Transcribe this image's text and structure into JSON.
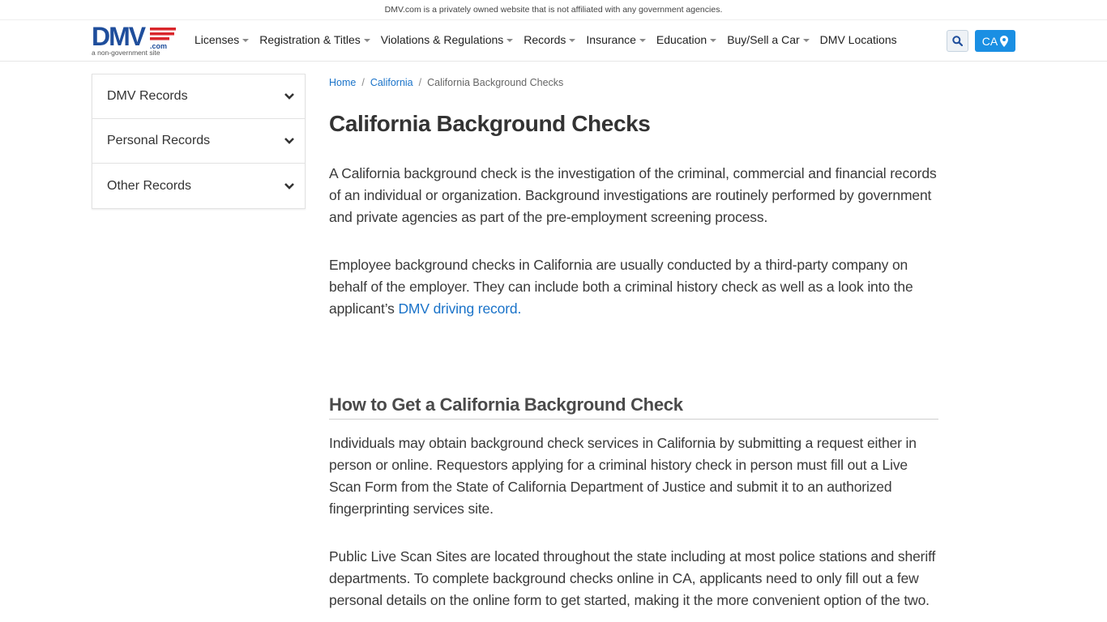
{
  "disclaimer": "DMV.com is a privately owned website that is not affiliated with any government agencies.",
  "logo": {
    "wordmark": "DMV",
    "suffix": ".com",
    "tagline": "a non-government site",
    "brand_color": "#1f4e9c",
    "accent_color": "#d9262b"
  },
  "nav": [
    {
      "label": "Licenses",
      "has_dropdown": true
    },
    {
      "label": "Registration & Titles",
      "has_dropdown": true
    },
    {
      "label": "Violations & Regulations",
      "has_dropdown": true
    },
    {
      "label": "Records",
      "has_dropdown": true
    },
    {
      "label": "Insurance",
      "has_dropdown": true
    },
    {
      "label": "Education",
      "has_dropdown": true
    },
    {
      "label": "Buy/Sell a Car",
      "has_dropdown": true
    },
    {
      "label": "DMV Locations",
      "has_dropdown": false
    }
  ],
  "search": {
    "icon": "search-icon"
  },
  "state_selector": {
    "label": "CA",
    "icon": "map-pin-icon",
    "color": "#1a8fe3"
  },
  "sidebar": {
    "items": [
      {
        "label": "DMV Records",
        "icon": "chevron-down-icon"
      },
      {
        "label": "Personal Records",
        "icon": "chevron-down-icon"
      },
      {
        "label": "Other Records",
        "icon": "chevron-down-icon"
      }
    ]
  },
  "breadcrumb": {
    "home": "Home",
    "state": "California",
    "sep": "/",
    "current": "California Background Checks"
  },
  "article": {
    "title": "California Background Checks",
    "p1": "A California background check is the investigation of the criminal, commercial and financial records of an individual or organization. Background investigations are routinely performed by government and private agencies as part of the pre-employment screening process.",
    "p2_text": "Employee background checks in California are usually conducted by a third-party company on behalf of the employer. They can include both a criminal history check as well as a look into the applicant’s ",
    "p2_link": "DMV driving record.",
    "h2": "How to Get a California Background Check",
    "p3": "Individuals may obtain background check services in California by submitting a request either in person or online. Requestors applying for a criminal history check in person must fill out a Live Scan Form from the State of California Department of Justice and submit it to an authorized fingerprinting services site.",
    "p4": "Public Live Scan Sites are located throughout the state including at most police stations and sheriff departments. To complete background checks online in CA, applicants need to only fill out a few personal details on the online form to get started, making it the more convenient option of the two."
  }
}
